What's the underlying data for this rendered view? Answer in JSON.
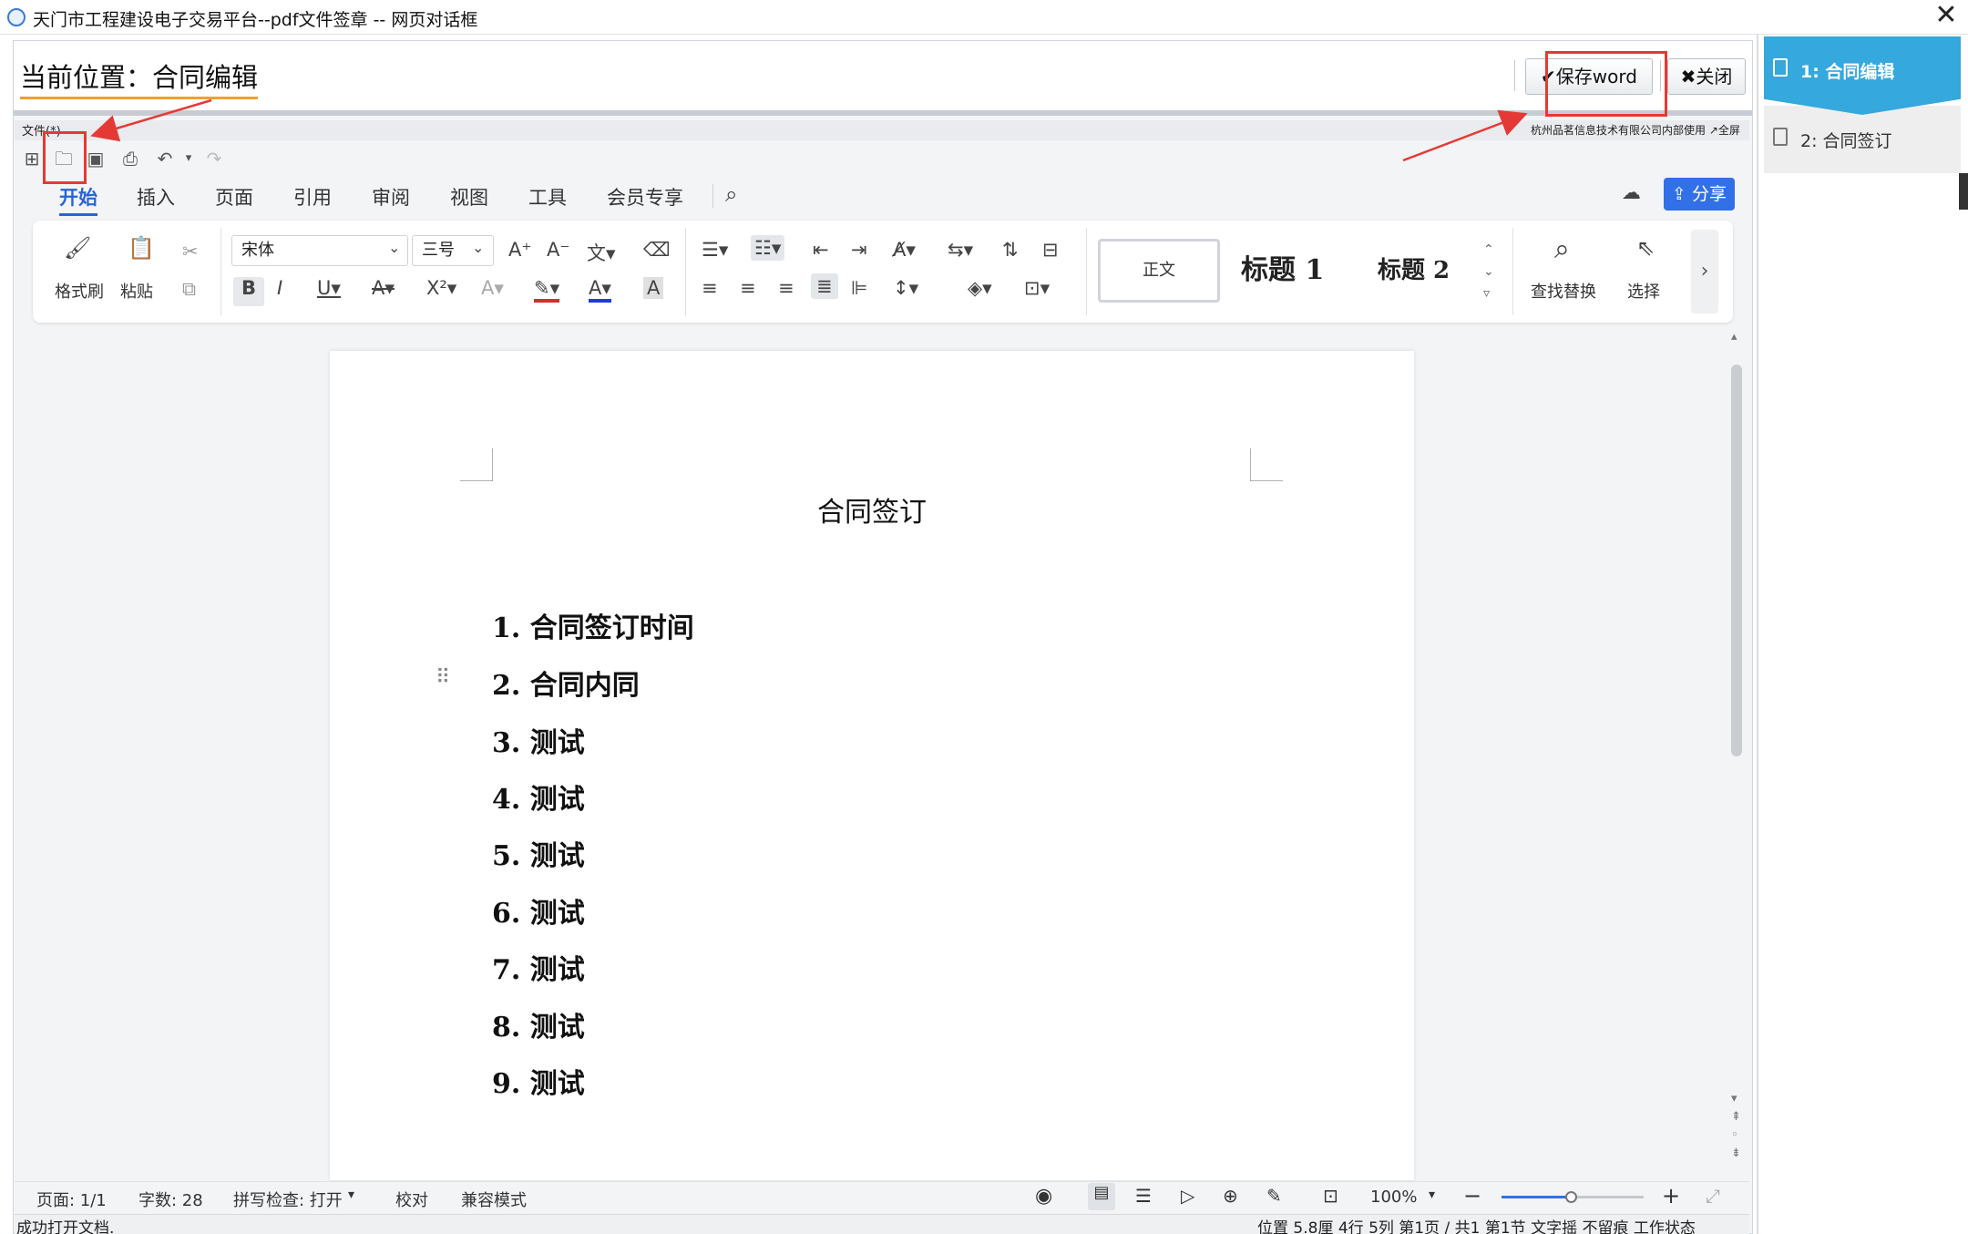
{
  "window": {
    "title": "天门市工程建设电子交易平台--pdf文件签章 -- 网页对话框",
    "close_glyph": "✕"
  },
  "location": {
    "label": "当前位置：合同编辑",
    "save_button": "✔保存word",
    "close_button": "✖关闭"
  },
  "editor": {
    "file_menu": "文件(*)",
    "vendor": "杭州品茗信息技术有限公司内部使用  ↗全屏",
    "tabs": [
      "开始",
      "插入",
      "页面",
      "引用",
      "审阅",
      "视图",
      "工具",
      "会员专享"
    ],
    "share_button": "分享",
    "ribbon": {
      "format_painter": "格式刷",
      "paste": "粘贴",
      "font_name": "宋体",
      "font_size": "三号",
      "styles": [
        "正文",
        "标题 1",
        "标题 2"
      ],
      "find_replace": "查找替换",
      "select": "选择"
    }
  },
  "document": {
    "title": "合同签订",
    "items": [
      "1. 合同签订时间",
      "2. 合同内同",
      "3. 测试",
      "4. 测试",
      "5. 测试",
      "6. 测试",
      "7. 测试",
      "8. 测试",
      "9. 测试"
    ]
  },
  "status": {
    "page": "页面: 1/1",
    "word_count": "字数: 28",
    "spell_check": "拼写检查: 打开",
    "proofread": "校对",
    "compat_mode": "兼容模式",
    "zoom": "100%",
    "message": "成功打开文档.",
    "position": "位置 5.8厘 4行 5列  第1页 / 共1  第1节  文字摇  不留痕  工作状态"
  },
  "steps": [
    {
      "label": "1:  合同编辑",
      "active": true
    },
    {
      "label": "2:  合同签订",
      "active": false
    }
  ],
  "colors": {
    "accent": "#2a63d6",
    "step_active": "#35a8dd",
    "annotation_red": "#e53935",
    "underline_orange": "#f0a030"
  }
}
